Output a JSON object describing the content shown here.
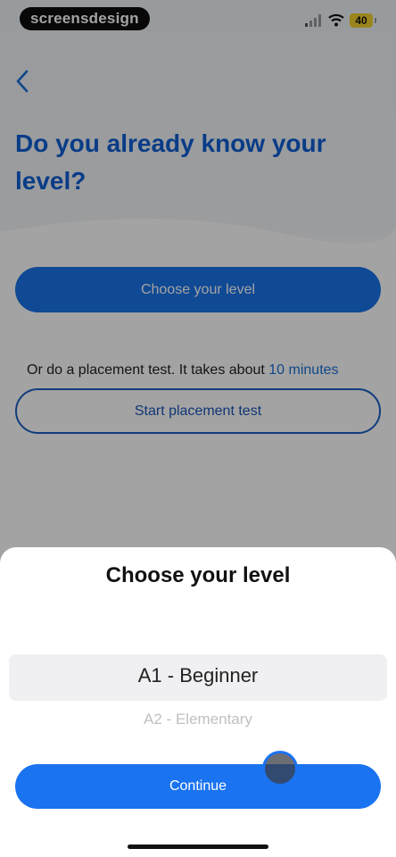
{
  "status_bar": {
    "brand": "screensdesign",
    "battery": "40",
    "signal_icon": "signal-icon",
    "wifi_icon": "wifi-icon"
  },
  "header": {
    "back_icon": "back-chevron-icon",
    "title": "Do you already know your level?"
  },
  "main": {
    "choose_level_button": "Choose your level",
    "placement_note": "Or do a placement test. It takes about ",
    "placement_duration": "10 minutes",
    "start_test_button": "Start placement test"
  },
  "sheet": {
    "title": "Choose your level",
    "options": [
      "A1 - Beginner",
      "A2 - Elementary"
    ],
    "selected": "A1 - Beginner",
    "continue_button": "Continue"
  },
  "colors": {
    "accent": "#1a73e8",
    "title": "#0f5fd3"
  }
}
